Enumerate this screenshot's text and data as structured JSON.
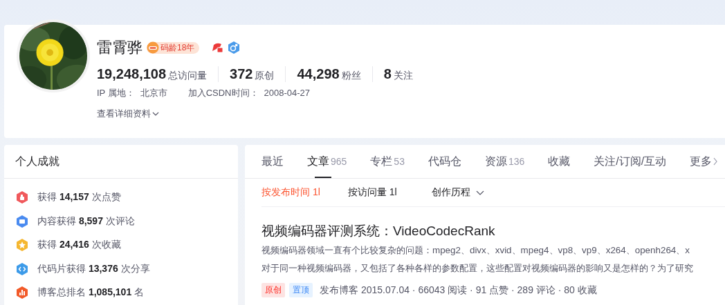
{
  "profile": {
    "name": "雷霄骅",
    "badge": "码龄18年",
    "stats": [
      {
        "value": "19,248,108",
        "label": "总访问量"
      },
      {
        "value": "372",
        "label": "原创"
      },
      {
        "value": "44,298",
        "label": "粉丝"
      },
      {
        "value": "8",
        "label": "关注"
      }
    ],
    "info": [
      {
        "label": "IP 属地：",
        "value": "北京市"
      },
      {
        "label": "加入CSDN时间：",
        "value": "2008-04-27"
      }
    ],
    "details_link": "查看详细资料"
  },
  "achievements": {
    "title": "个人成就",
    "items": [
      {
        "text": "获得 **14,157** 次点赞",
        "color": "#f0595c"
      },
      {
        "text": "内容获得 **8,597** 次评论",
        "color": "#4a8bf0"
      },
      {
        "text": "获得 **24,416** 次收藏",
        "color": "#f5b731"
      },
      {
        "text": "代码片获得 **13,376** 次分享",
        "color": "#3d9be9"
      },
      {
        "text": "博客总排名 **1,085,101** 名",
        "color": "#f25a29"
      }
    ]
  },
  "tabs": [
    {
      "label": "最近",
      "selected": false
    },
    {
      "label": "文章",
      "count": "965",
      "selected": true
    },
    {
      "label": "专栏",
      "count": "53",
      "selected": false
    },
    {
      "label": "代码仓",
      "selected": false
    },
    {
      "label": "资源",
      "count": "136",
      "selected": false
    },
    {
      "label": "收藏",
      "selected": false
    },
    {
      "label": "关注/订阅/互动",
      "selected": false
    },
    {
      "label": "更多",
      "selected": false
    }
  ],
  "sorts": [
    {
      "label": "按发布时间 1l",
      "selected": true
    },
    {
      "label": "按访问量 1l",
      "selected": false
    }
  ],
  "history_menu": "创作历程",
  "articles": [
    {
      "title": "视频编码器评测系统：VideoCodecRank",
      "description": [
        "视频编码器领域一直有个比较复杂的问题：mpeg2、divx、xvid、mpeg4、vp8、vp9、x264、openh264、x",
        "对于同一种视频编码器，又包括了各种各样的参数配置，这些配置对视频编码器的影响又是怎样的？为了研究"
      ],
      "tags": [
        {
          "label": "原创",
          "kind": "original"
        },
        {
          "label": "置顶",
          "kind": "pinned"
        }
      ],
      "meta": "发布博客 2015.07.04 · 66043 阅读 · 91 点赞 · 289 评论 · 80 收藏"
    }
  ]
}
